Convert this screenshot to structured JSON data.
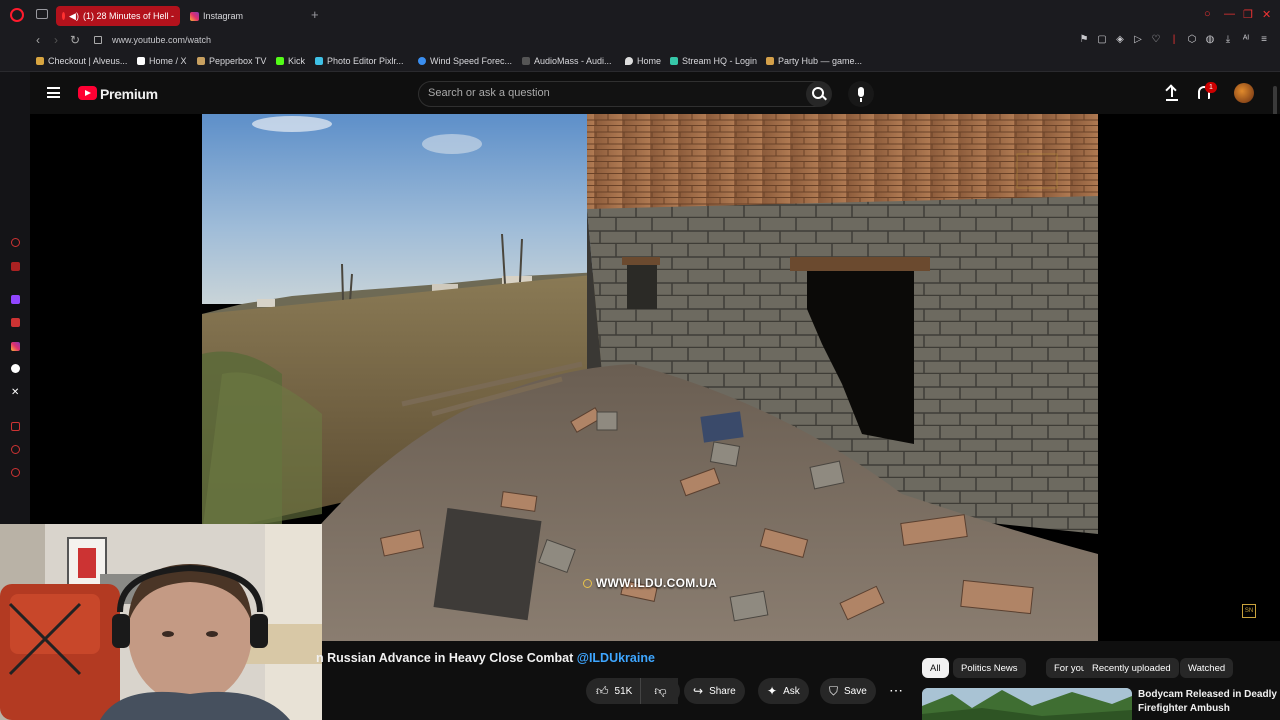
{
  "browser": {
    "tabs": [
      {
        "label": "(1) 28 Minutes of Hell -",
        "active": true
      },
      {
        "label": "Instagram",
        "active": false
      }
    ],
    "new_tab": "+",
    "url": "www.youtube.com/watch",
    "bookmarks": [
      {
        "label": "Checkout | Alveus...",
        "color": "#d8a540"
      },
      {
        "label": "Home / X",
        "color": "#ffffff"
      },
      {
        "label": "Pepperbox TV",
        "color": "#c8a060"
      },
      {
        "label": "Kick",
        "color": "#53fc18"
      },
      {
        "label": "Photo Editor Pixlr...",
        "color": "#3fc1e6"
      },
      {
        "label": "Wind Speed Forec...",
        "color": "#3a8ef0"
      },
      {
        "label": "AudioMass - Audi...",
        "color": "#555555"
      },
      {
        "label": "Home",
        "color": "#dddddd"
      },
      {
        "label": "Stream HQ - Login",
        "color": "#36c7a8"
      },
      {
        "label": "Party Hub — game...",
        "color": "#d4a04a"
      }
    ]
  },
  "youtube": {
    "brand": "Premium",
    "search_placeholder": "Search or ask a question",
    "notifications_count": "1",
    "video": {
      "watermark": "WWW.ILDU.COM.UA",
      "corner_badge": "SN",
      "title": "n Russian Advance in Heavy Close Combat",
      "channel_handle": "@ILDUkraine"
    },
    "actions": {
      "like_count": "51K",
      "share": "Share",
      "ask": "Ask",
      "save": "Save",
      "more": "⋯"
    },
    "chips": [
      {
        "label": "All",
        "selected": true
      },
      {
        "label": "Politics News",
        "selected": false
      },
      {
        "label": "For you",
        "selected": false
      },
      {
        "label": "Recently uploaded",
        "selected": false
      },
      {
        "label": "Watched",
        "selected": false
      }
    ],
    "recommendation": {
      "title": "Bodycam Released in Deadly Firefighter Ambush"
    }
  },
  "colors": {
    "accent": "#ff0033",
    "active_tab": "#b3121c",
    "link": "#3ea6ff"
  }
}
